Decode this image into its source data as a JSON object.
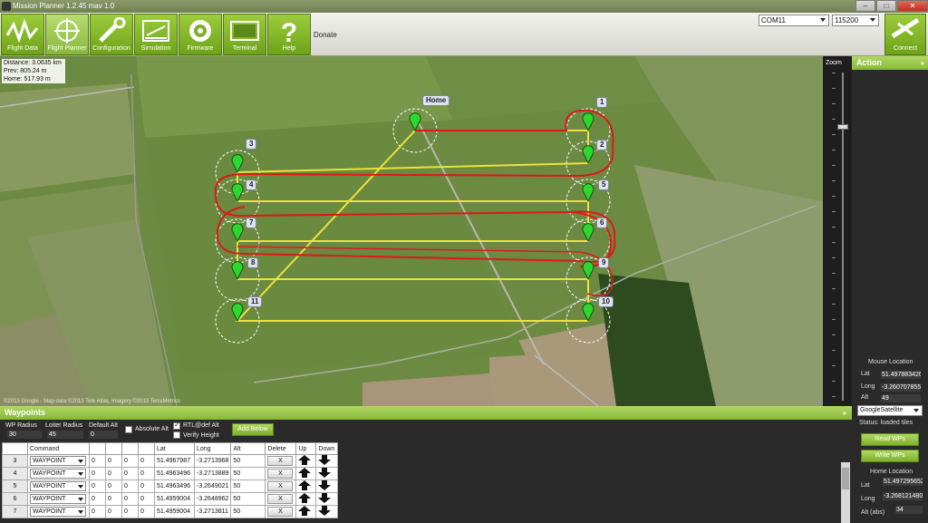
{
  "window": {
    "title": "Mission Planner 1.2.45 mav 1.0",
    "minimize": "–",
    "maximize": "□",
    "close": "✕"
  },
  "toolbar": {
    "buttons": [
      {
        "label": "Flight Data",
        "icon": "flight-data-icon"
      },
      {
        "label": "Flight Planner",
        "icon": "crosshair-icon"
      },
      {
        "label": "Configuration",
        "icon": "wrench-icon"
      },
      {
        "label": "Simulation",
        "icon": "simulation-icon"
      },
      {
        "label": "Firmware",
        "icon": "disc-icon"
      },
      {
        "label": "Terminal",
        "icon": "terminal-icon"
      },
      {
        "label": "Help",
        "icon": "help-icon"
      }
    ],
    "donate": "Donate",
    "com_port": "COM11",
    "baud": "115200",
    "connect": "Connect"
  },
  "map_info": {
    "distance": "Distance: 3.0635 km",
    "prev": "Prev: 805.24 m",
    "home": "Home: 517.93 m"
  },
  "map": {
    "copyright": "©2013 Google - Map data ©2013 Tele Atlas, Imagery ©2013 TerraMetrics",
    "home_label": "Home",
    "waypoint_labels": [
      "1",
      "2",
      "3",
      "4",
      "5",
      "6",
      "7",
      "8",
      "9",
      "10",
      "11"
    ]
  },
  "zoom": {
    "label": "Zoom"
  },
  "action": {
    "title": "Action",
    "mouse_location": "Mouse Location",
    "lat_label": "Lat",
    "lat": "51.4978834265",
    "long_label": "Long",
    "long": "-3.26070785522",
    "alt_label": "Alt",
    "alt": "49",
    "map_type": "GoogleSatellite",
    "status": "Status: loaded tiles",
    "read_wps": "Read WPs",
    "write_wps": "Write WPs",
    "home_location": "Home Location",
    "home_lat_label": "Lat",
    "home_lat": "51.4972956525",
    "home_long_label": "Long",
    "home_long": "-3.26812148094",
    "home_alt_label": "Alt (abs)",
    "home_alt": "34"
  },
  "waypoints": {
    "title": "Waypoints",
    "wp_radius_label": "WP Radius",
    "wp_radius": "30",
    "loiter_radius_label": "Loiter Radius",
    "loiter_radius": "45",
    "default_alt_label": "Default Alt",
    "default_alt": "0",
    "absolute_alt": "Absolute Alt",
    "rtl_def_alt": "RTL@def Alt",
    "verify_height": "Verify Height",
    "add_below": "Add Below",
    "columns": [
      "",
      "Command",
      "",
      "",
      "",
      "",
      "Lat",
      "Long",
      "Alt",
      "Delete",
      "Up",
      "Down"
    ],
    "rows": [
      {
        "n": "3",
        "cmd": "WAYPOINT",
        "p1": "0",
        "p2": "0",
        "p3": "0",
        "p4": "0",
        "lat": "51.4967987",
        "long": "-3.2713968",
        "alt": "50"
      },
      {
        "n": "4",
        "cmd": "WAYPOINT",
        "p1": "0",
        "p2": "0",
        "p3": "0",
        "p4": "0",
        "lat": "51.4963496",
        "long": "-3.2713889",
        "alt": "50"
      },
      {
        "n": "5",
        "cmd": "WAYPOINT",
        "p1": "0",
        "p2": "0",
        "p3": "0",
        "p4": "0",
        "lat": "51.4963496",
        "long": "-3.2649021",
        "alt": "50"
      },
      {
        "n": "6",
        "cmd": "WAYPOINT",
        "p1": "0",
        "p2": "0",
        "p3": "0",
        "p4": "0",
        "lat": "51.4959004",
        "long": "-3.2648962",
        "alt": "50"
      },
      {
        "n": "7",
        "cmd": "WAYPOINT",
        "p1": "0",
        "p2": "0",
        "p3": "0",
        "p4": "0",
        "lat": "51.4959004",
        "long": "-3.2713811",
        "alt": "50"
      }
    ],
    "delete_label": "X"
  }
}
